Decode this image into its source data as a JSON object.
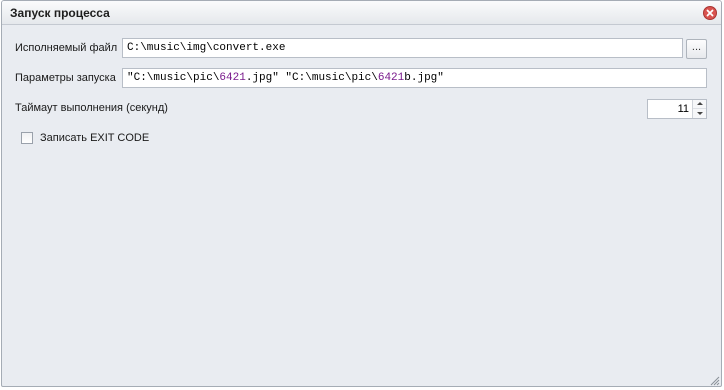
{
  "dialog": {
    "title": "Запуск процесса",
    "close_icon": "close-circle-icon",
    "accent_close_color": "#d9534f"
  },
  "form": {
    "executable": {
      "label": "Исполняемый файл",
      "value": "C:\\music\\img\\convert.exe",
      "browse_label": "..."
    },
    "params": {
      "label": "Параметры запуска",
      "value": "\"C:\\music\\pic\\6421.jpg\" \"C:\\music\\pic\\6421b.jpg\"",
      "segments": [
        "\"C:\\music\\pic\\",
        "6421",
        ".jpg\" \"C:\\music\\pic\\",
        "6421",
        "b.jpg\""
      ]
    },
    "timeout": {
      "label": "Таймаут выполнения (секунд)",
      "value": "11"
    },
    "exit_code": {
      "label": "Записать EXIT CODE",
      "checked": false
    }
  }
}
